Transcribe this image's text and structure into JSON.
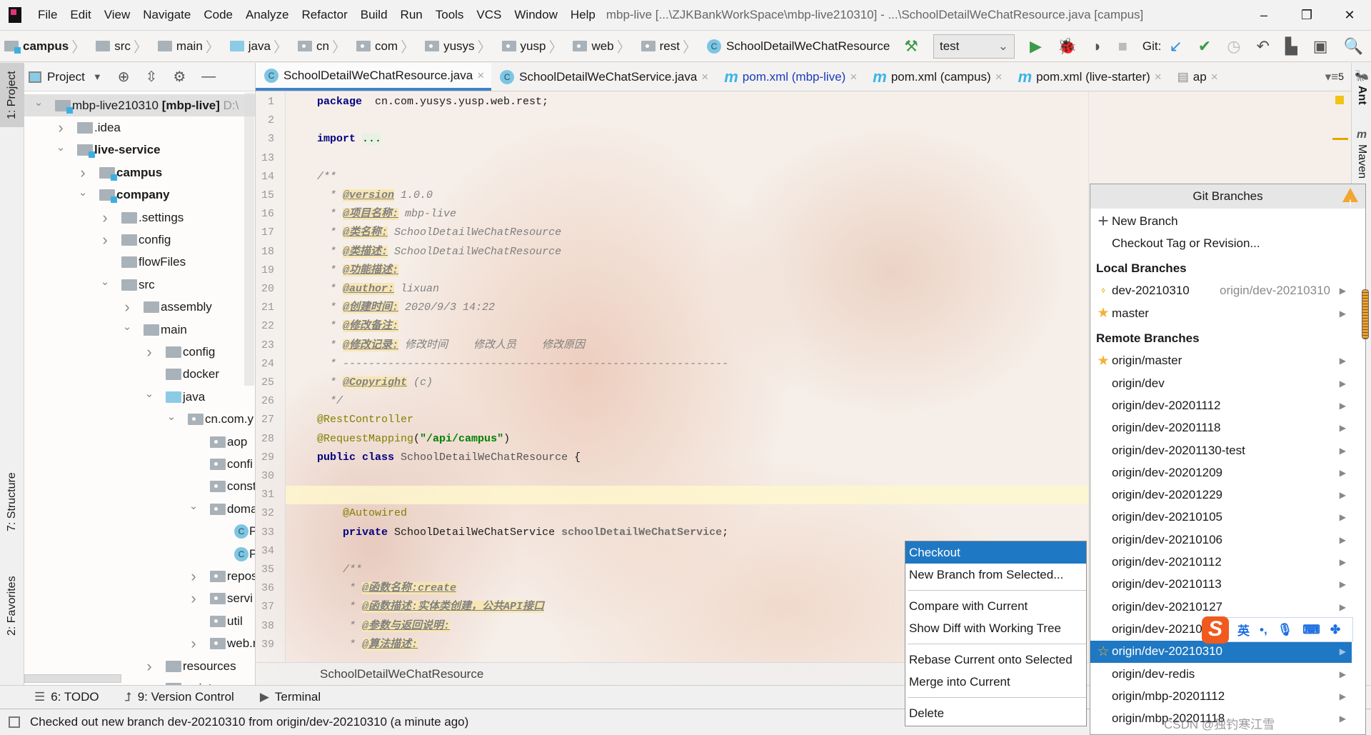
{
  "menubar": {
    "items": [
      "File",
      "Edit",
      "View",
      "Navigate",
      "Code",
      "Analyze",
      "Refactor",
      "Build",
      "Run",
      "Tools",
      "VCS",
      "Window",
      "Help"
    ],
    "title": "mbp-live [...\\ZJKBankWorkSpace\\mbp-live210310] - ...\\SchoolDetailWeChatResource.java [campus]",
    "window_controls": [
      "–",
      "❐",
      "✕"
    ]
  },
  "toolbar": {
    "breadcrumb": [
      {
        "label": "campus",
        "icon": "module-folder",
        "bold": true
      },
      {
        "label": "src",
        "icon": "folder"
      },
      {
        "label": "main",
        "icon": "folder"
      },
      {
        "label": "java",
        "icon": "source-folder"
      },
      {
        "label": "cn",
        "icon": "package"
      },
      {
        "label": "com",
        "icon": "package"
      },
      {
        "label": "yusys",
        "icon": "package"
      },
      {
        "label": "yusp",
        "icon": "package"
      },
      {
        "label": "web",
        "icon": "package"
      },
      {
        "label": "rest",
        "icon": "package"
      },
      {
        "label": "SchoolDetailWeChatResource",
        "icon": "class"
      }
    ],
    "run_config": "test",
    "git_label": "Git:"
  },
  "left_tabs": {
    "project": "1: Project",
    "structure": "7: Structure",
    "favorites": "2: Favorites"
  },
  "right_tabs": {
    "ant": "Ant",
    "maven": "Maven"
  },
  "project_panel": {
    "title": "Project",
    "tree": [
      {
        "label": "mbp-live210310",
        "suffix": " [mbp-live]",
        "hint": " D:\\",
        "depth": 0,
        "arrow": "open",
        "icon": "module",
        "selected": true
      },
      {
        "label": ".idea",
        "depth": 1,
        "arrow": "closed",
        "icon": "folder"
      },
      {
        "label": "live-service",
        "depth": 1,
        "arrow": "open",
        "icon": "module",
        "bold": true
      },
      {
        "label": "campus",
        "depth": 2,
        "arrow": "closed",
        "icon": "module",
        "bold": true
      },
      {
        "label": "company",
        "depth": 2,
        "arrow": "open",
        "icon": "module",
        "bold": true
      },
      {
        "label": ".settings",
        "depth": 3,
        "arrow": "closed",
        "icon": "folder"
      },
      {
        "label": "config",
        "depth": 3,
        "arrow": "closed",
        "icon": "folder"
      },
      {
        "label": "flowFiles",
        "depth": 3,
        "arrow": "none",
        "icon": "folder"
      },
      {
        "label": "src",
        "depth": 3,
        "arrow": "open",
        "icon": "folder"
      },
      {
        "label": "assembly",
        "depth": 4,
        "arrow": "closed",
        "icon": "folder"
      },
      {
        "label": "main",
        "depth": 4,
        "arrow": "open",
        "icon": "folder"
      },
      {
        "label": "config",
        "depth": 5,
        "arrow": "closed",
        "icon": "folder"
      },
      {
        "label": "docker",
        "depth": 5,
        "arrow": "none",
        "icon": "folder"
      },
      {
        "label": "java",
        "depth": 5,
        "arrow": "open",
        "icon": "source"
      },
      {
        "label": "cn.com.y",
        "depth": 6,
        "arrow": "open",
        "icon": "package"
      },
      {
        "label": "aop",
        "depth": 7,
        "arrow": "none",
        "icon": "package"
      },
      {
        "label": "confi",
        "depth": 7,
        "arrow": "none",
        "icon": "package"
      },
      {
        "label": "const",
        "depth": 7,
        "arrow": "none",
        "icon": "package"
      },
      {
        "label": "doma",
        "depth": 7,
        "arrow": "open",
        "icon": "package"
      },
      {
        "label": "P",
        "depth": 8,
        "arrow": "none",
        "icon": "class"
      },
      {
        "label": "P",
        "depth": 8,
        "arrow": "none",
        "icon": "class"
      },
      {
        "label": "repos",
        "depth": 7,
        "arrow": "closed",
        "icon": "package"
      },
      {
        "label": "servi",
        "depth": 7,
        "arrow": "closed",
        "icon": "package"
      },
      {
        "label": "util",
        "depth": 7,
        "arrow": "none",
        "icon": "package"
      },
      {
        "label": "web.r",
        "depth": 7,
        "arrow": "closed",
        "icon": "package"
      },
      {
        "label": "resources",
        "depth": 5,
        "arrow": "closed",
        "icon": "resources"
      },
      {
        "label": "scripts",
        "depth": 5,
        "arrow": "closed",
        "icon": "folder"
      }
    ]
  },
  "tabs": [
    {
      "label": "SchoolDetailWeChatResource.java",
      "icon": "class",
      "active": true
    },
    {
      "label": "SchoolDetailWeChatService.java",
      "icon": "class"
    },
    {
      "label": "pom.xml (mbp-live)",
      "icon": "maven",
      "modified": true
    },
    {
      "label": "pom.xml (campus)",
      "icon": "maven"
    },
    {
      "label": "pom.xml (live-starter)",
      "icon": "maven"
    },
    {
      "label": "ap",
      "icon": "file"
    }
  ],
  "tab_overflow": "5",
  "editor": {
    "lines": [
      {
        "n": "1",
        "p": [
          [
            "kw",
            "package"
          ],
          [
            "",
            "  cn.com.yusys.yusp.web.rest;"
          ]
        ]
      },
      {
        "n": "2",
        "p": []
      },
      {
        "n": "3",
        "p": [
          [
            "kw",
            "import"
          ],
          [
            "",
            " "
          ],
          [
            "imp",
            "..."
          ]
        ]
      },
      {
        "n": "13",
        "p": []
      },
      {
        "n": "14",
        "p": [
          [
            "doc",
            "/**"
          ]
        ]
      },
      {
        "n": "15",
        "p": [
          [
            "doc",
            "  * "
          ],
          [
            "tag",
            "@version"
          ],
          [
            "doc",
            " 1.0.0"
          ]
        ]
      },
      {
        "n": "16",
        "p": [
          [
            "doc",
            "  * "
          ],
          [
            "tag",
            "@项目名称:"
          ],
          [
            "doc",
            " mbp-live"
          ]
        ]
      },
      {
        "n": "17",
        "p": [
          [
            "doc",
            "  * "
          ],
          [
            "tag",
            "@类名称:"
          ],
          [
            "doc",
            " SchoolDetailWeChatResource"
          ]
        ]
      },
      {
        "n": "18",
        "p": [
          [
            "doc",
            "  * "
          ],
          [
            "tag",
            "@类描述:"
          ],
          [
            "doc",
            " SchoolDetailWeChatResource"
          ]
        ]
      },
      {
        "n": "19",
        "p": [
          [
            "doc",
            "  * "
          ],
          [
            "tag",
            "@功能描述:"
          ]
        ]
      },
      {
        "n": "20",
        "p": [
          [
            "doc",
            "  * "
          ],
          [
            "tag",
            "@author:"
          ],
          [
            "doc",
            " lixuan"
          ]
        ]
      },
      {
        "n": "21",
        "p": [
          [
            "doc",
            "  * "
          ],
          [
            "tag",
            "@创建时间:"
          ],
          [
            "doc",
            " 2020/9/3 14:22"
          ]
        ]
      },
      {
        "n": "22",
        "p": [
          [
            "doc",
            "  * "
          ],
          [
            "tag",
            "@修改备注:"
          ]
        ]
      },
      {
        "n": "23",
        "p": [
          [
            "doc",
            "  * "
          ],
          [
            "tag",
            "@修改记录:"
          ],
          [
            "doc",
            " 修改时间    修改人员    修改原因"
          ]
        ]
      },
      {
        "n": "24",
        "p": [
          [
            "doc",
            "  * ------------------------------------------------------------"
          ]
        ]
      },
      {
        "n": "25",
        "p": [
          [
            "doc",
            "  * "
          ],
          [
            "tag",
            "@Copyright"
          ],
          [
            "doc",
            " (c)"
          ]
        ]
      },
      {
        "n": "26",
        "p": [
          [
            "doc",
            "  */"
          ]
        ]
      },
      {
        "n": "27",
        "p": [
          [
            "ann",
            "@RestController"
          ]
        ]
      },
      {
        "n": "28",
        "p": [
          [
            "ann",
            "@RequestMapping"
          ],
          [
            "",
            "("
          ],
          [
            "str",
            "\"/api/campus\""
          ],
          [
            "",
            ")"
          ]
        ]
      },
      {
        "n": "29",
        "p": [
          [
            "kw",
            "public"
          ],
          [
            "",
            " "
          ],
          [
            "kw",
            "class"
          ],
          [
            "doc2",
            " SchoolDetailWeChatResource"
          ],
          [
            "",
            " {"
          ]
        ]
      },
      {
        "n": "30",
        "p": []
      },
      {
        "n": "31",
        "p": [],
        "current": true
      },
      {
        "n": "32",
        "p": [
          [
            "ann",
            "    @Autowired"
          ]
        ]
      },
      {
        "n": "33",
        "p": [
          [
            "kw",
            "    private"
          ],
          [
            "",
            " SchoolDetailWeChatService "
          ],
          [
            "fld",
            "schoolDetailWeChatService"
          ],
          [
            "",
            ";"
          ]
        ]
      },
      {
        "n": "34",
        "p": []
      },
      {
        "n": "35",
        "p": [
          [
            "doc",
            "    /**"
          ]
        ]
      },
      {
        "n": "36",
        "p": [
          [
            "doc",
            "     * "
          ],
          [
            "tag",
            "@函数名称:create"
          ]
        ]
      },
      {
        "n": "37",
        "p": [
          [
            "doc",
            "     * "
          ],
          [
            "tag",
            "@函数描述:实体类创建，公共API接口"
          ]
        ]
      },
      {
        "n": "38",
        "p": [
          [
            "doc",
            "     * "
          ],
          [
            "tag",
            "@参数与返回说明:"
          ]
        ]
      },
      {
        "n": "39",
        "p": [
          [
            "doc",
            "     * "
          ],
          [
            "tag",
            "@算法描述:"
          ]
        ]
      }
    ],
    "breadcrumb": "SchoolDetailWeChatResource"
  },
  "bottom_tools": [
    {
      "label": "6: TODO",
      "icon": "list-icon"
    },
    {
      "label": "9: Version Control",
      "icon": "vcs-icon"
    },
    {
      "label": "Terminal",
      "icon": "terminal-icon"
    }
  ],
  "status": "Checked out new branch dev-20210310 from origin/dev-20210310 (a minute ago)",
  "git_branches": {
    "title": "Git Branches",
    "actions": [
      {
        "label": "New Branch",
        "icon": "plus"
      },
      {
        "label": "Checkout Tag or Revision..."
      }
    ],
    "local_header": "Local Branches",
    "local": [
      {
        "label": "dev-20210310",
        "tracking": "origin/dev-20210310",
        "icon": "tag"
      },
      {
        "label": "master",
        "icon": "star"
      }
    ],
    "remote_header": "Remote Branches",
    "remote": [
      {
        "label": "origin/master",
        "icon": "star"
      },
      {
        "label": "origin/dev"
      },
      {
        "label": "origin/dev-20201112"
      },
      {
        "label": "origin/dev-20201118"
      },
      {
        "label": "origin/dev-20201130-test"
      },
      {
        "label": "origin/dev-20201209"
      },
      {
        "label": "origin/dev-20201229"
      },
      {
        "label": "origin/dev-20210105"
      },
      {
        "label": "origin/dev-20210106"
      },
      {
        "label": "origin/dev-20210112"
      },
      {
        "label": "origin/dev-20210113"
      },
      {
        "label": "origin/dev-20210127"
      },
      {
        "label": "origin/dev-20210"
      },
      {
        "label": "origin/dev-20210310",
        "icon": "star-outline",
        "selected": true
      },
      {
        "label": "origin/dev-redis"
      },
      {
        "label": "origin/mbp-20201112"
      },
      {
        "label": "origin/mbp-20201118"
      }
    ]
  },
  "context_menu": {
    "groups": [
      [
        "Checkout",
        "New Branch from Selected..."
      ],
      [
        "Compare with Current",
        "Show Diff with Working Tree"
      ],
      [
        "Rebase Current onto Selected",
        "Merge into Current"
      ],
      [
        "Delete"
      ]
    ],
    "highlighted": "Checkout"
  },
  "ime": {
    "lang": "英",
    "punct": "•,"
  },
  "watermark": "CSDN @独钓寒江雪",
  "colors": {
    "selection": "#1f78c3",
    "tab_active_underline": "#4083c9",
    "keyword": "#000080",
    "string": "#008000",
    "annotation": "#808000",
    "doc_tag_bg": "#f7e6b4"
  }
}
